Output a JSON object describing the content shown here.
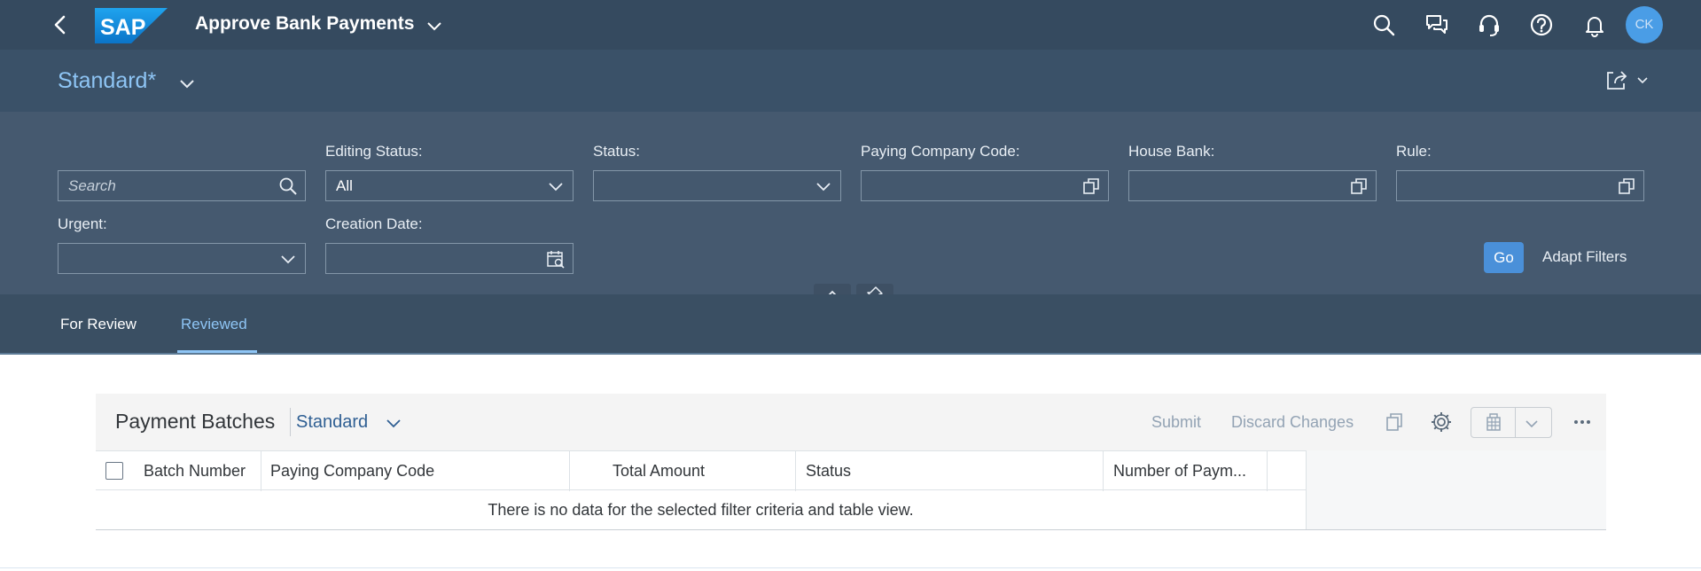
{
  "shell": {
    "logo_text": "SAP",
    "app_title": "Approve Bank Payments",
    "avatar_initials": "CK",
    "icons": [
      "back-icon",
      "search-icon",
      "chat-icon",
      "headset-icon",
      "help-icon",
      "bell-icon"
    ]
  },
  "variant": {
    "name": "Standard*",
    "share_icon": "share-icon"
  },
  "filters": {
    "search_placeholder": "Search",
    "editing_status_label": "Editing Status:",
    "editing_status_value": "All",
    "status_label": "Status:",
    "status_value": "",
    "paying_company_code_label": "Paying Company Code:",
    "house_bank_label": "House Bank:",
    "rule_label": "Rule:",
    "urgent_label": "Urgent:",
    "creation_date_label": "Creation Date:",
    "go_label": "Go",
    "adapt_filters_label": "Adapt Filters"
  },
  "tabs": [
    {
      "label": "For Review",
      "selected": false
    },
    {
      "label": "Reviewed",
      "selected": true
    }
  ],
  "table": {
    "title": "Payment Batches",
    "variant": "Standard",
    "actions": {
      "submit": "Submit",
      "discard": "Discard Changes"
    },
    "columns": [
      "Batch Number",
      "Paying Company Code",
      "Total Amount",
      "Status",
      "Number of Paym..."
    ],
    "rows": [],
    "no_data_text": "There is no data for the selected filter criteria and table view."
  },
  "colors": {
    "shell_bg": "#354a5f",
    "filter_bg": "#45596f",
    "accent": "#8ec5f5",
    "go_button": "#4a90d9"
  }
}
